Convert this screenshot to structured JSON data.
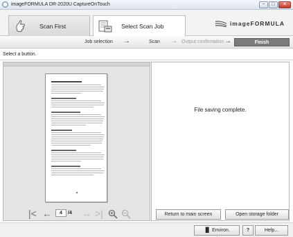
{
  "window": {
    "title": "imageFORMULA DR-2020U CaptureOnTouch",
    "controls": {
      "minimize": "−",
      "maximize": "□",
      "close": "✕"
    }
  },
  "header": {
    "tabs": [
      {
        "label": "Scan First",
        "icon": "scan-first-icon",
        "active": false
      },
      {
        "label": "Select Scan Job",
        "icon": "select-scan-job-icon",
        "active": true
      }
    ],
    "brand": "imageFORMULA"
  },
  "steps": {
    "items": [
      {
        "label": "Job selection",
        "state": "done"
      },
      {
        "label": "Scan",
        "state": "done"
      },
      {
        "label": "Output confirmation",
        "state": "skipped"
      }
    ],
    "arrow": "→",
    "finish_label": "Finish"
  },
  "hint": "Select a button.",
  "preview": {
    "current_page": "4",
    "page_total": "/4",
    "nav_icons": [
      "first-page-icon",
      "prev-page-icon",
      "next-page-icon",
      "last-page-icon",
      "zoom-in-icon",
      "zoom-out-icon"
    ]
  },
  "result": {
    "message": "File saving complete.",
    "return_button": "Return to main screen",
    "open_folder_button": "Open storage folder"
  },
  "footer": {
    "environ_settings": "Environ. Settings",
    "help_q": "?",
    "help": "Help..."
  },
  "colors": {
    "finish_bg": "#7c7c7c",
    "pane_bg": "#e4e4e4",
    "titlebar_close": "#c23a2a"
  }
}
